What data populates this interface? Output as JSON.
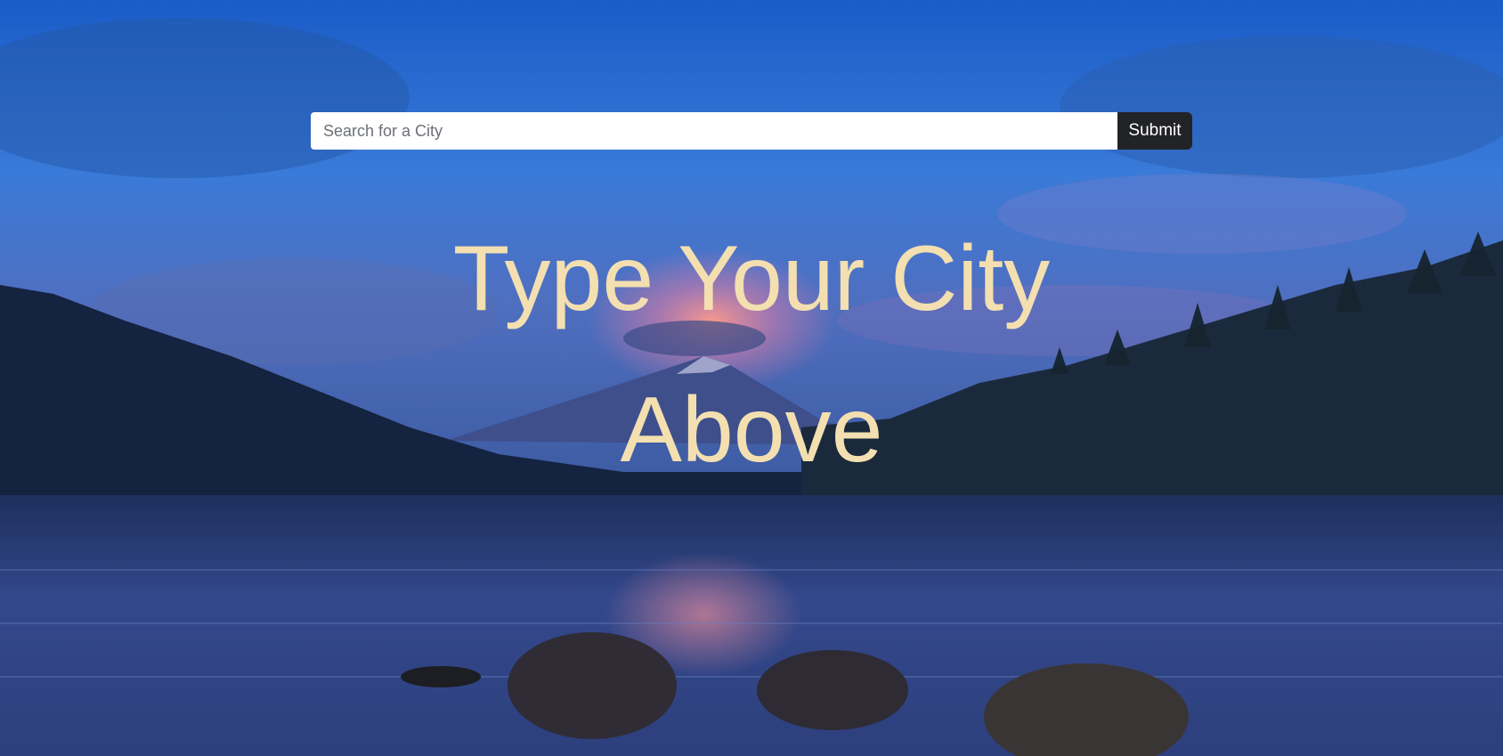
{
  "search": {
    "placeholder": "Search for a City",
    "value": "",
    "submit_label": "Submit"
  },
  "headline": {
    "line1": "Type Your City",
    "line2": "Above"
  },
  "colors": {
    "headline_text": "#f3dfb0",
    "button_background": "#222326",
    "button_text": "#ffffff",
    "input_background": "#ffffff"
  },
  "background": {
    "icon": "mountain-lake-landscape"
  }
}
